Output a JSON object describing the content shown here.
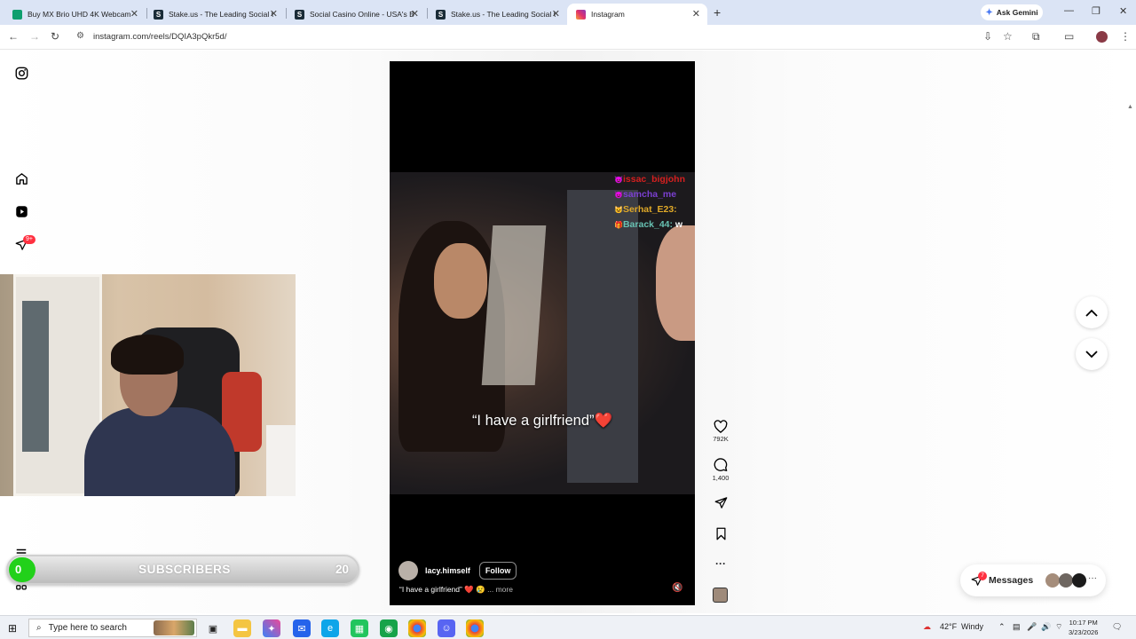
{
  "browser": {
    "tabs": [
      {
        "title": "Buy MX Brio UHD 4K Webcam",
        "fav_color": "#0e9f6e",
        "fav_glyph": "●"
      },
      {
        "title": "Stake.us - The Leading Social C",
        "fav_color": "#1a2c38",
        "fav_glyph": "S"
      },
      {
        "title": "Social Casino Online - USA's Be",
        "fav_color": "#1a2c38",
        "fav_glyph": "S"
      },
      {
        "title": "Stake.us - The Leading Social C",
        "fav_color": "#1a2c38",
        "fav_glyph": "S"
      },
      {
        "title": "Instagram",
        "fav_color": "#e1306c",
        "fav_glyph": "◎",
        "active": true
      }
    ],
    "ask_gemini": "Ask Gemini",
    "url": "instagram.com/reels/DQIA3pQkr5d/"
  },
  "sidebar": {
    "icons": [
      "instagram-icon",
      "home-icon",
      "reels-icon",
      "send-icon",
      "menu-icon",
      "more-apps-icon"
    ],
    "notification_badge": "9+"
  },
  "reel": {
    "chat": [
      {
        "user": "issac_bigjohn",
        "text": "",
        "color": "#d61f1f"
      },
      {
        "user": "samcha_me",
        "text": "",
        "color": "#7b3fd1"
      },
      {
        "user": "Serhat_E23:",
        "text": "",
        "color": "#e0a928"
      },
      {
        "user": "Barack_44:",
        "text": " w",
        "color": "#67c1b2"
      }
    ],
    "caption_overlay": "“I have a girlfriend”❤️",
    "author": "lacy.himself",
    "follow_label": "Follow",
    "description": "“I have a girlfriend” ❤️ 😢",
    "more_label": "... more",
    "likes": "792K",
    "comments": "1,400"
  },
  "messages": {
    "label": "Messages",
    "badge": "7"
  },
  "overlay": {
    "current_subs": "0",
    "subscribers_label": "SUBSCRIBERS",
    "goal": "20",
    "progress": 0
  },
  "taskbar": {
    "search_placeholder": "Type here to search",
    "weather": "42°F",
    "weather_desc": "Windy",
    "time": "10:17 PM",
    "date": "3/23/2026"
  }
}
